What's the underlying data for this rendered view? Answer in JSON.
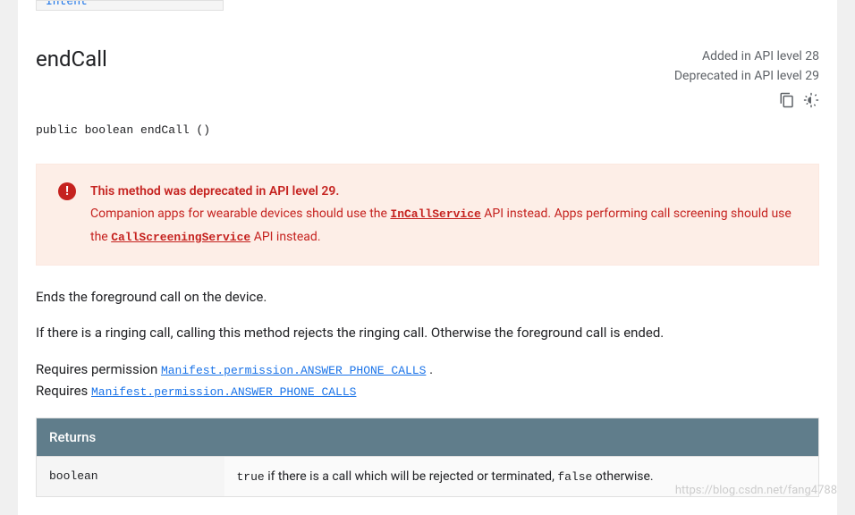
{
  "fragment": "Intent",
  "method": {
    "name": "endCall",
    "added": "Added in API level 28",
    "deprecated_meta": "Deprecated in API level 29",
    "signature": "public boolean endCall ()"
  },
  "deprecation": {
    "title": "This method was deprecated in API level 29.",
    "pre1": "Companion apps for wearable devices should use the ",
    "link1": "InCallService",
    "mid1": " API instead. Apps performing call screening should use the ",
    "link2": "CallScreeningService",
    "post1": " API instead."
  },
  "description": {
    "p1": "Ends the foreground call on the device.",
    "p2": "If there is a ringing call, calling this method rejects the ringing call. Otherwise the foreground call is ended.",
    "req_pre1": "Requires permission ",
    "req_code1": "Manifest.permission.ANSWER_PHONE_CALLS",
    "req_post1": " .",
    "req_pre2": "Requires ",
    "req_code2": "Manifest.permission.ANSWER_PHONE_CALLS"
  },
  "returns": {
    "header": "Returns",
    "type": "boolean",
    "val1": "true",
    "mid": " if there is a call which will be rejected or terminated, ",
    "val2": "false",
    "post": " otherwise."
  },
  "watermark": "https://blog.csdn.net/fang4788"
}
